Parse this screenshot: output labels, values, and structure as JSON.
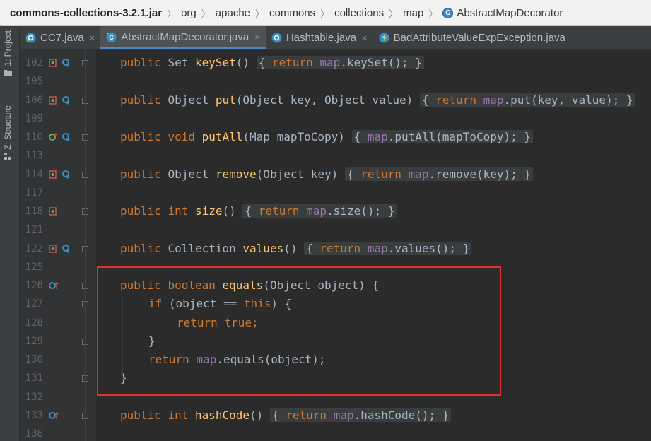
{
  "breadcrumb": {
    "items": [
      "commons-collections-3.2.1.jar",
      "org",
      "apache",
      "commons",
      "collections",
      "map",
      "AbstractMapDecorator"
    ],
    "class_icon_letter": "C"
  },
  "sidebar": {
    "project_label": "1: Project",
    "structure_label": "Z: Structure"
  },
  "tabs": [
    {
      "label": "CC7.java"
    },
    {
      "label": "AbstractMapDecorator.java"
    },
    {
      "label": "Hashtable.java"
    },
    {
      "label": "BadAttributeValueExpException.java"
    }
  ],
  "tab_close_glyph": "×",
  "line_numbers": [
    "102",
    "105",
    "106",
    "109",
    "110",
    "113",
    "114",
    "117",
    "118",
    "121",
    "122",
    "125",
    "126",
    "127",
    "128",
    "129",
    "130",
    "131",
    "132",
    "133",
    "136"
  ],
  "code": {
    "l102": {
      "kw1": "public",
      "type": "Set",
      "fn": "keySet",
      "p": "()",
      "ob": "{",
      "ret": "return",
      "fld": "map",
      "tail": ".keySet();",
      "cb": "}"
    },
    "l106": {
      "kw1": "public",
      "type": "Object",
      "fn": "put",
      "sig": "(Object key, Object value)",
      "ob": "{",
      "ret": "return",
      "fld": "map",
      "tail": ".put(key, value);",
      "cb": "}"
    },
    "l110": {
      "kw1": "public",
      "kw2": "void",
      "fn": "putAll",
      "sig": "(Map mapToCopy)",
      "ob": "{",
      "fld": "map",
      "tail": ".putAll(mapToCopy);",
      "cb": "}"
    },
    "l114": {
      "kw1": "public",
      "type": "Object",
      "fn": "remove",
      "sig": "(Object key)",
      "ob": "{",
      "ret": "return",
      "fld": "map",
      "tail": ".remove(key);",
      "cb": "}"
    },
    "l118": {
      "kw1": "public",
      "kw2": "int",
      "fn": "size",
      "p": "()",
      "ob": "{",
      "ret": "return",
      "fld": "map",
      "tail": ".size();",
      "cb": "}"
    },
    "l122": {
      "kw1": "public",
      "type": "Collection",
      "fn": "values",
      "p": "()",
      "ob": "{",
      "ret": "return",
      "fld": "map",
      "tail": ".values();",
      "cb": "}"
    },
    "l126": {
      "kw1": "public",
      "kw2": "boolean",
      "fn": "equals",
      "sig": "(Object object) {"
    },
    "l127": {
      "kw1": "if",
      "mid": "(object == ",
      "kw2": "this",
      "end": ") {"
    },
    "l128": {
      "kw1": "return",
      "kw2": "true",
      "end": ";"
    },
    "l129": {
      "text": "}"
    },
    "l130": {
      "kw1": "return",
      "fld": "map",
      "tail": ".equals(object);"
    },
    "l131": {
      "text": "}"
    },
    "l133": {
      "kw1": "public",
      "kw2": "int",
      "fn": "hashCode",
      "p": "()",
      "ob": "{",
      "ret": "return",
      "fld": "map",
      "tail": ".hashCode();",
      "cb": "}"
    }
  },
  "colors": {
    "keyword": "#cc7832",
    "method": "#ffc66d",
    "field": "#9876aa",
    "text": "#a9b7c6",
    "highlight_box": "#e0302f",
    "editor_bg": "#2b2b2b"
  }
}
